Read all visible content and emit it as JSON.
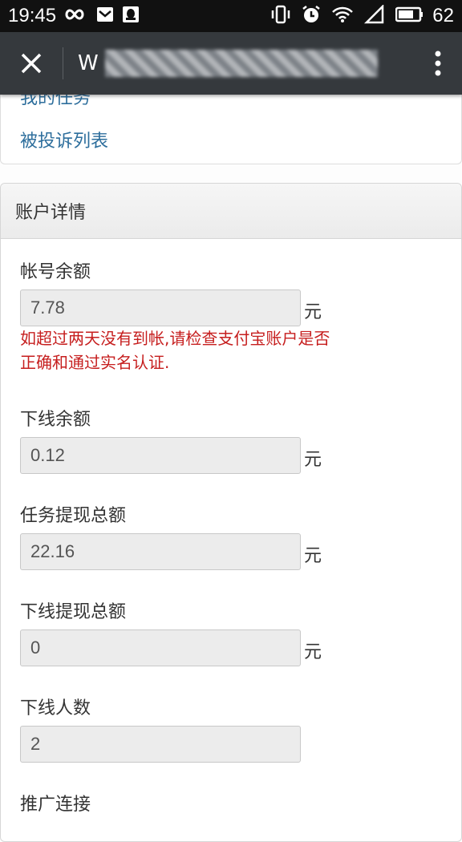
{
  "status_bar": {
    "time": "19:45",
    "battery": "62",
    "icons_left": [
      "infinity-icon",
      "mail-icon",
      "qq-icon"
    ],
    "icons_right": [
      "vibrate-icon",
      "alarm-icon",
      "wifi-icon",
      "signal-icon",
      "battery-icon"
    ]
  },
  "nav": {
    "title_initial": "W"
  },
  "links": {
    "my_tasks": "我的任务",
    "complaint_list": "被投诉列表"
  },
  "account": {
    "heading": "账户详情",
    "fields": [
      {
        "label": "帐号余额",
        "value": "7.78",
        "unit": "元"
      },
      {
        "label": "下线余额",
        "value": "0.12",
        "unit": "元"
      },
      {
        "label": "任务提现总额",
        "value": "22.16",
        "unit": "元"
      },
      {
        "label": "下线提现总额",
        "value": "0",
        "unit": "元"
      },
      {
        "label": "下线人数",
        "value": "2",
        "unit": ""
      },
      {
        "label": "推广连接",
        "value": "",
        "unit": ""
      }
    ],
    "warning": "如超过两天没有到帐,请检查支付宝账户是否正确和通过实名认证."
  }
}
